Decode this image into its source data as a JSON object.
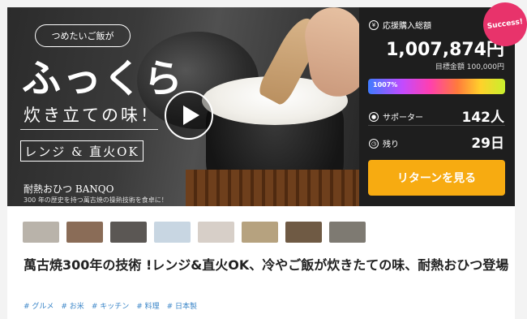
{
  "hero": {
    "badge": "つめたいご飯が",
    "headline": "ふっくら",
    "subline": "炊き立ての味！",
    "boxed": "レンジ & 直火OK",
    "brand": "耐熱おひつ BANQO",
    "brand_sub": "300 年の歴史を持つ萬古焼の操熱技術を食卓に！"
  },
  "panel": {
    "total_label": "応援購入総額",
    "amount": "1,007,874円",
    "goal": "目標金額 100,000円",
    "progress_label": "1007%",
    "progress_percent": 1007,
    "supporters_label": "サポーター",
    "supporters_value": "142人",
    "days_label": "残り",
    "days_value": "29日",
    "return_button": "リターンを見る",
    "success_badge": "Success!"
  },
  "colors": {
    "accent": "#f7ab11",
    "success": "#e8336b",
    "tag": "#3b86c8"
  },
  "thumbnails": [
    {
      "color": "#b9b3aa"
    },
    {
      "color": "#8a6c57"
    },
    {
      "color": "#5b5754"
    },
    {
      "color": "#c8d6e2"
    },
    {
      "color": "#d7cfc8"
    },
    {
      "color": "#b6a27f"
    },
    {
      "color": "#6f5a44"
    },
    {
      "color": "#7e7a72"
    }
  ],
  "title": "萬古焼300年の技術 !レンジ&直火OK、冷やご飯が炊きたての味、耐熱おひつ登場",
  "tags": [
    "# グルメ",
    "# お米",
    "# キッチン",
    "# 料理",
    "# 日本製"
  ]
}
